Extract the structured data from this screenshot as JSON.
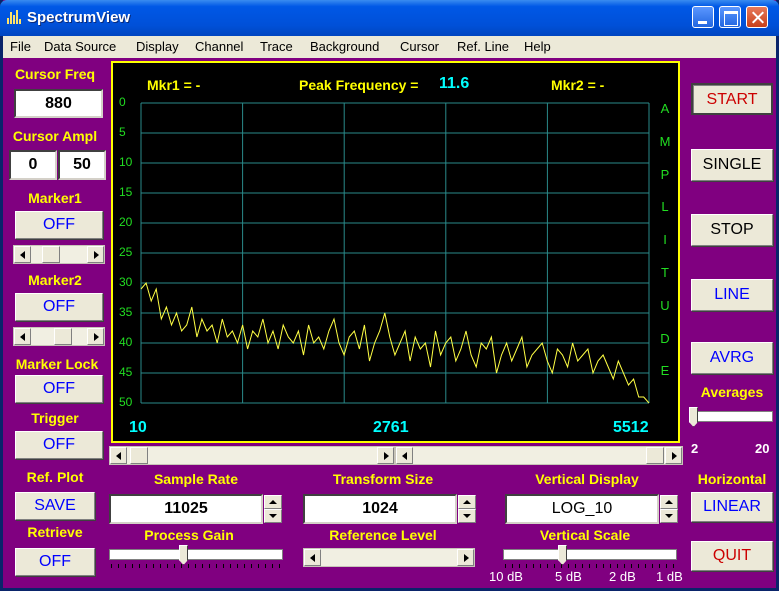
{
  "window": {
    "title": "SpectrumView"
  },
  "menu": [
    "File",
    "Data Source",
    "Display",
    "Channel",
    "Trace",
    "Background",
    "Cursor",
    "Ref. Line",
    "Help"
  ],
  "left_panel": {
    "cursor_freq_label": "Cursor Freq",
    "cursor_freq_value": "880",
    "cursor_ampl_label": "Cursor Ampl",
    "cursor_ampl_left": "0",
    "cursor_ampl_right": "50",
    "marker1_label": "Marker1",
    "marker1_button": "OFF",
    "marker2_label": "Marker2",
    "marker2_button": "OFF",
    "marker_lock_label": "Marker Lock",
    "marker_lock_button": "OFF",
    "trigger_label": "Trigger",
    "trigger_button": "OFF",
    "ref_plot_label": "Ref. Plot",
    "ref_plot_button": "SAVE",
    "retrieve_label": "Retrieve",
    "retrieve_button": "OFF"
  },
  "plot": {
    "mkr1": "Mkr1 =   -",
    "peak_label": "Peak Frequency =",
    "peak_value": "11.6",
    "mkr2": "Mkr2 =   -",
    "side_label": [
      "A",
      "M",
      "P",
      "L",
      "I",
      "T",
      "U",
      "D",
      "E"
    ],
    "trace_color": "#ffff44",
    "grid_color": "#2a8a8a"
  },
  "chart_data": {
    "type": "line",
    "x_ticks": [
      "10",
      "2761",
      "5512"
    ],
    "y_ticks": [
      "0",
      "5",
      "10",
      "15",
      "20",
      "25",
      "30",
      "35",
      "40",
      "45",
      "50"
    ],
    "ylabel": "AMPLITUDE",
    "xlim": [
      10,
      5512
    ],
    "ylim": [
      0,
      50
    ],
    "y_inverted": true,
    "x": [
      10,
      65,
      120,
      175,
      230,
      285,
      340,
      395,
      450,
      505,
      560,
      615,
      670,
      725,
      780,
      835,
      890,
      945,
      1000,
      1055,
      1110,
      1165,
      1220,
      1275,
      1330,
      1385,
      1440,
      1495,
      1550,
      1605,
      1660,
      1715,
      1770,
      1825,
      1880,
      1935,
      1990,
      2045,
      2100,
      2155,
      2210,
      2265,
      2320,
      2375,
      2430,
      2485,
      2540,
      2595,
      2650,
      2705,
      2760,
      2815,
      2870,
      2925,
      2980,
      3035,
      3090,
      3145,
      3200,
      3255,
      3310,
      3365,
      3420,
      3475,
      3530,
      3585,
      3640,
      3695,
      3750,
      3805,
      3860,
      3915,
      3970,
      4025,
      4080,
      4135,
      4190,
      4245,
      4300,
      4355,
      4410,
      4465,
      4520,
      4575,
      4630,
      4685,
      4740,
      4795,
      4850,
      4905,
      4960,
      5015,
      5070,
      5125,
      5180,
      5235,
      5290,
      5345,
      5400,
      5455,
      5512
    ],
    "y": [
      31,
      30,
      33,
      31,
      36,
      34,
      37,
      35,
      38,
      37,
      34,
      39,
      36,
      38,
      37,
      40,
      36,
      39,
      38,
      40,
      37,
      41,
      38,
      39,
      36,
      40,
      38,
      41,
      37,
      39,
      40,
      38,
      42,
      37,
      40,
      39,
      41,
      38,
      36,
      40,
      42,
      39,
      38,
      41,
      37,
      43,
      40,
      38,
      35,
      39,
      42,
      40,
      38,
      43,
      39,
      41,
      40,
      44,
      38,
      42,
      40,
      39,
      43,
      41,
      38,
      42,
      44,
      40,
      41,
      39,
      45,
      42,
      40,
      43,
      41,
      39,
      44,
      42,
      41,
      40,
      43,
      45,
      41,
      42,
      44,
      40,
      43,
      42,
      41,
      45,
      43,
      42,
      44,
      46,
      43,
      45,
      47,
      46,
      49,
      49,
      50
    ]
  },
  "scrollbars": {
    "plot_scroll_pos": 0
  },
  "bottom": {
    "sample_rate_label": "Sample Rate",
    "sample_rate_value": "11025",
    "transform_size_label": "Transform Size",
    "transform_size_value": "1024",
    "vertical_display_label": "Vertical Display",
    "vertical_display_value": "LOG_10",
    "horizontal_label": "Horizontal",
    "horizontal_button": "LINEAR",
    "process_gain_label": "Process Gain",
    "reference_level_label": "Reference Level",
    "vertical_scale_label": "Vertical Scale",
    "vertical_scale_ticks": [
      "10 dB",
      "5 dB",
      "2 dB",
      "1 dB"
    ]
  },
  "right_panel": {
    "start_button": "START",
    "single_button": "SINGLE",
    "stop_button": "STOP",
    "line_button": "LINE",
    "avrg_button": "AVRG",
    "averages_label": "Averages",
    "averages_min": "2",
    "averages_max": "20",
    "quit_button": "QUIT"
  }
}
